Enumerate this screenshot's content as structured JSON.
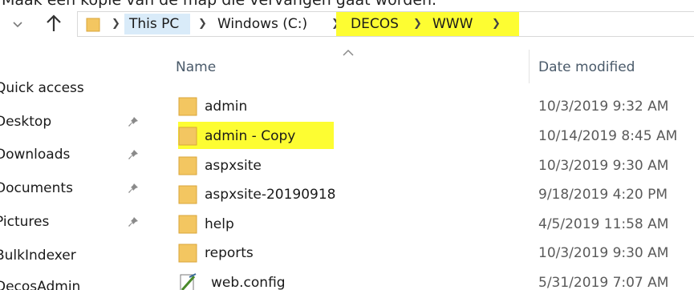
{
  "caption": "Maak een kopie van de map die vervangen gaat worden.",
  "address_bar": {
    "crumbs": [
      "This PC",
      "Windows (C:)",
      "DECOS",
      "WWW"
    ],
    "highlight_color": "#fdfd32"
  },
  "icons": {
    "back": "chevron-down-icon",
    "up": "up-arrow-icon",
    "folder": "folder-icon",
    "pin": "pin-icon",
    "config": "config-file-icon"
  },
  "nav_pane": {
    "items": [
      {
        "label": "Quick access",
        "pinned": false
      },
      {
        "label": "Desktop",
        "pinned": true
      },
      {
        "label": "Downloads",
        "pinned": true
      },
      {
        "label": "Documents",
        "pinned": true
      },
      {
        "label": "Pictures",
        "pinned": true
      },
      {
        "label": "BulkIndexer",
        "pinned": false
      },
      {
        "label": "DecosAdmin",
        "pinned": false
      }
    ]
  },
  "columns": {
    "name": "Name",
    "date_modified": "Date modified"
  },
  "files": [
    {
      "name": "admin",
      "date": "10/3/2019 9:32 AM",
      "type": "folder",
      "highlighted": false
    },
    {
      "name": "admin - Copy",
      "date": "10/14/2019 8:45 AM",
      "type": "folder",
      "highlighted": true
    },
    {
      "name": "aspxsite",
      "date": "10/3/2019 9:30 AM",
      "type": "folder",
      "highlighted": false
    },
    {
      "name": "aspxsite-20190918",
      "date": "9/18/2019 4:20 PM",
      "type": "folder",
      "highlighted": false
    },
    {
      "name": "help",
      "date": "4/5/2019 11:58 AM",
      "type": "folder",
      "highlighted": false
    },
    {
      "name": "reports",
      "date": "10/3/2019 9:30 AM",
      "type": "folder",
      "highlighted": false
    },
    {
      "name": "web.config",
      "date": "5/31/2019 7:07 AM",
      "type": "config",
      "highlighted": false
    }
  ]
}
